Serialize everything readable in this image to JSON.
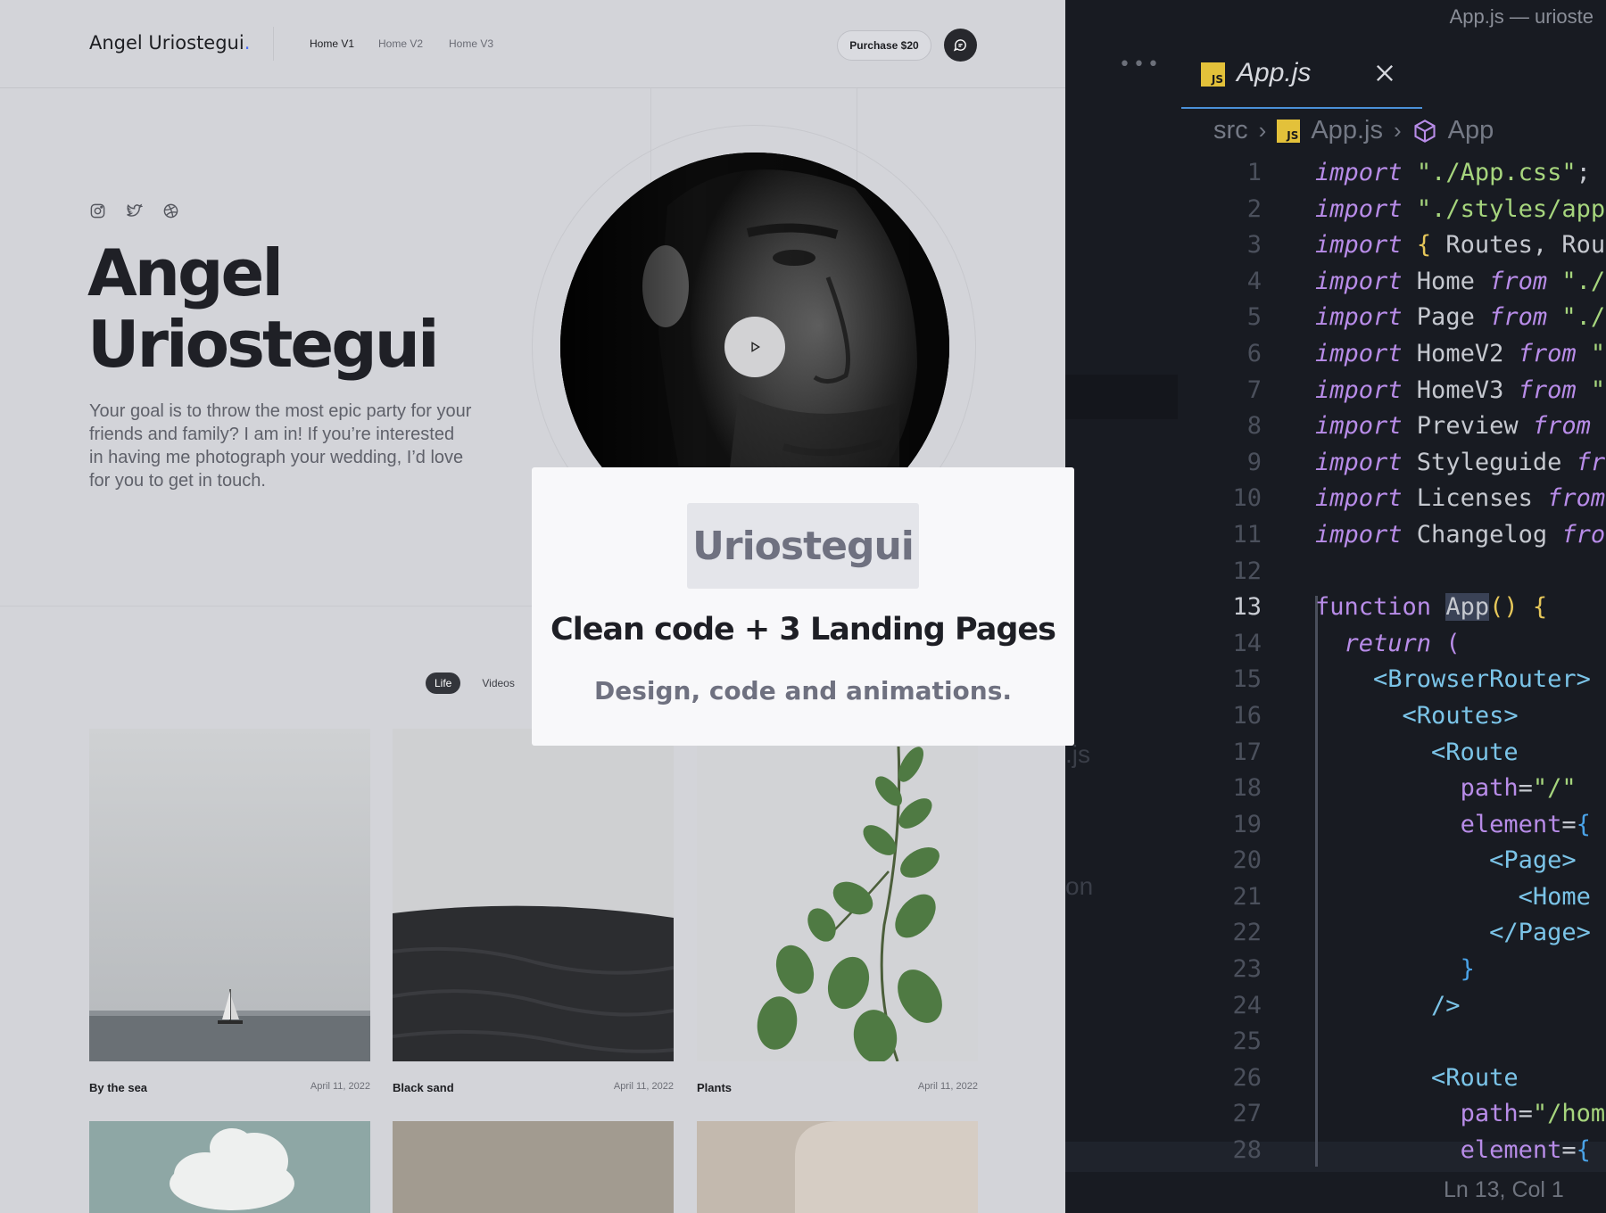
{
  "site": {
    "brand": "Angel Uriostegui",
    "brand_dot": ".",
    "nav": [
      {
        "label": "Home V1",
        "active": true
      },
      {
        "label": "Home V2",
        "active": false
      },
      {
        "label": "Home V3",
        "active": false
      }
    ],
    "purchase_label": "Purchase $20",
    "social_icons": [
      "instagram-icon",
      "twitter-icon",
      "dribbble-icon"
    ],
    "hero": {
      "name_line1": "Angel",
      "name_line2": "Uriostegui",
      "description": "Your goal is to throw the most epic party for your friends and family? I am in! If you’re interested in having me photograph your wedding, I’d love for you to get in touch."
    },
    "filters": [
      {
        "label": "Life",
        "active": true
      },
      {
        "label": "Videos",
        "active": false
      }
    ],
    "gallery": [
      {
        "title": "By the sea",
        "date": "April 11, 2022"
      },
      {
        "title": "Black sand",
        "date": "April 11, 2022"
      },
      {
        "title": "Plants",
        "date": "April 11, 2022"
      }
    ]
  },
  "overlay": {
    "logo": "Uriostegui",
    "title": "Clean code + 3 Landing Pages",
    "subtitle": "Design, code and animations."
  },
  "editor": {
    "window_title": "App.js — urioste",
    "tab_label": "App.js",
    "badge": "JS",
    "breadcrumb": [
      "src",
      "App.js",
      "App"
    ],
    "status": "Ln 13, Col 1",
    "ghost_texts": [
      ".js",
      "on"
    ],
    "accent_color": "#e3c13a"
  }
}
